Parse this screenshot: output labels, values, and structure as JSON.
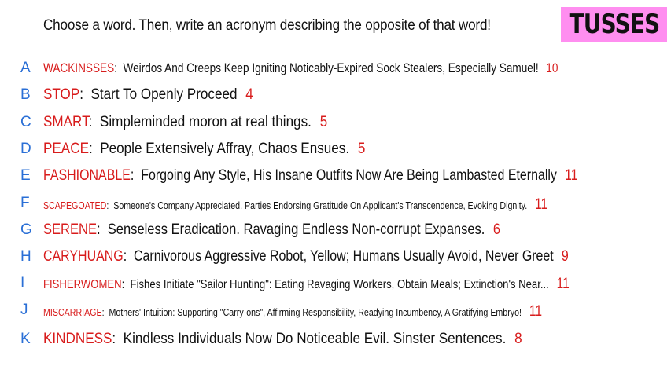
{
  "prompt": "Choose a word. Then, write an acronym describing the opposite of that word!",
  "player_name": "TUSSES",
  "colors": {
    "badge_bg": "#ff8ef0",
    "letter": "#2a6fd6",
    "word": "#d81c1c",
    "score": "#d81c1c"
  },
  "entries": [
    {
      "letter": "A",
      "word": "WACKINSSES",
      "definition": "Weirdos And Creeps Keep Igniting Noticably-Expired Sock Stealers, Especially Samuel!",
      "score": "10"
    },
    {
      "letter": "B",
      "word": "STOP",
      "definition": "Start To Openly Proceed",
      "score": "4"
    },
    {
      "letter": "C",
      "word": "SMART",
      "definition": "Simpleminded moron at real things.",
      "score": "5"
    },
    {
      "letter": "D",
      "word": "PEACE",
      "definition": "People Extensively Affray, Chaos Ensues.",
      "score": "5"
    },
    {
      "letter": "E",
      "word": "FASHIONABLE",
      "definition": "Forgoing Any Style, His Insane Outfits Now Are Being Lambasted Eternally",
      "score": "11"
    },
    {
      "letter": "F",
      "word": "SCAPEGOATED",
      "definition": "Someone's Company Appreciated. Parties Endorsing Gratitude On Applicant's Transcendence, Evoking Dignity.",
      "score": "11"
    },
    {
      "letter": "G",
      "word": "SERENE",
      "definition": "Senseless Eradication. Ravaging Endless Non-corrupt Expanses.",
      "score": "6"
    },
    {
      "letter": "H",
      "word": "CARYHUANG",
      "definition": "Carnivorous Aggressive Robot, Yellow; Humans Usually Avoid, Never Greet",
      "score": "9"
    },
    {
      "letter": "I",
      "word": "FISHERWOMEN",
      "definition": "Fishes Initiate \"Sailor Hunting\": Eating Ravaging Workers, Obtain Meals; Extinction's Near...",
      "score": "11"
    },
    {
      "letter": "J",
      "word": "MISCARRIAGE",
      "definition": "Mothers' Intuition: Supporting \"Carry-ons\", Affirming Responsibility, Readying Incumbency, A Gratifying Embryo!",
      "score": "11"
    },
    {
      "letter": "K",
      "word": "KINDNESS",
      "definition": "Kindless Individuals Now Do Noticeable Evil. Sinster Sentences.",
      "score": "8"
    }
  ]
}
